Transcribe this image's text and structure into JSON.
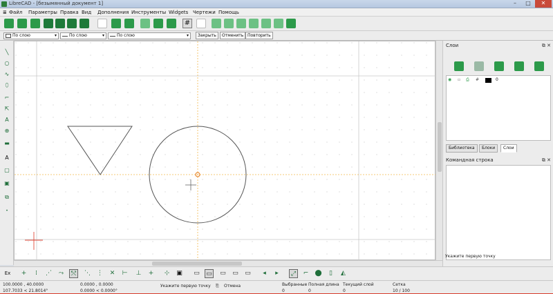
{
  "window": {
    "title": "LibreCAD - [безымянный документ 1]"
  },
  "menu": [
    "Файл",
    "Параметры",
    "Правка",
    "Вид",
    "Дополнения",
    "Инструменты",
    "Widgets",
    "Чертежи",
    "Помощь"
  ],
  "toolbar2": {
    "pen_color": "По слою",
    "pen_width": "По слою",
    "pen_type": "По слою",
    "close_label": "Закрыть",
    "undo_label": "Отменить",
    "redo_label": "Повторить"
  },
  "layers_panel": {
    "title": "Слои",
    "layer_name": "0",
    "tabs": [
      "Библиотека",
      "Блоки",
      "Слои"
    ],
    "active_tab": "Слои"
  },
  "command_panel": {
    "title": "Командная строка",
    "prompt": "Укажите первую точку"
  },
  "bottom_toolbar": {
    "snap_label": "Ex"
  },
  "status": {
    "abs_coord": "100.0000 , 40.0000",
    "abs_polar": "107.7033 < 21.8014°",
    "rel_coord": "0.0000 , 0.0000",
    "rel_polar": "0.0000 < 0.0000°",
    "prompt": "Укажите первую точку",
    "cancel": "Отмена",
    "selected_label": "Выбранные",
    "selected_value": "0",
    "length_label": "Полная длина",
    "length_value": "0",
    "layer_label": "Текущий слой",
    "layer_value": "0",
    "grid_label": "Сетка",
    "grid_value": "10 / 100"
  },
  "colors": {
    "accent": "#2c9a4a",
    "guide": "#f2b64a",
    "crosshair": "#e04a3a"
  }
}
